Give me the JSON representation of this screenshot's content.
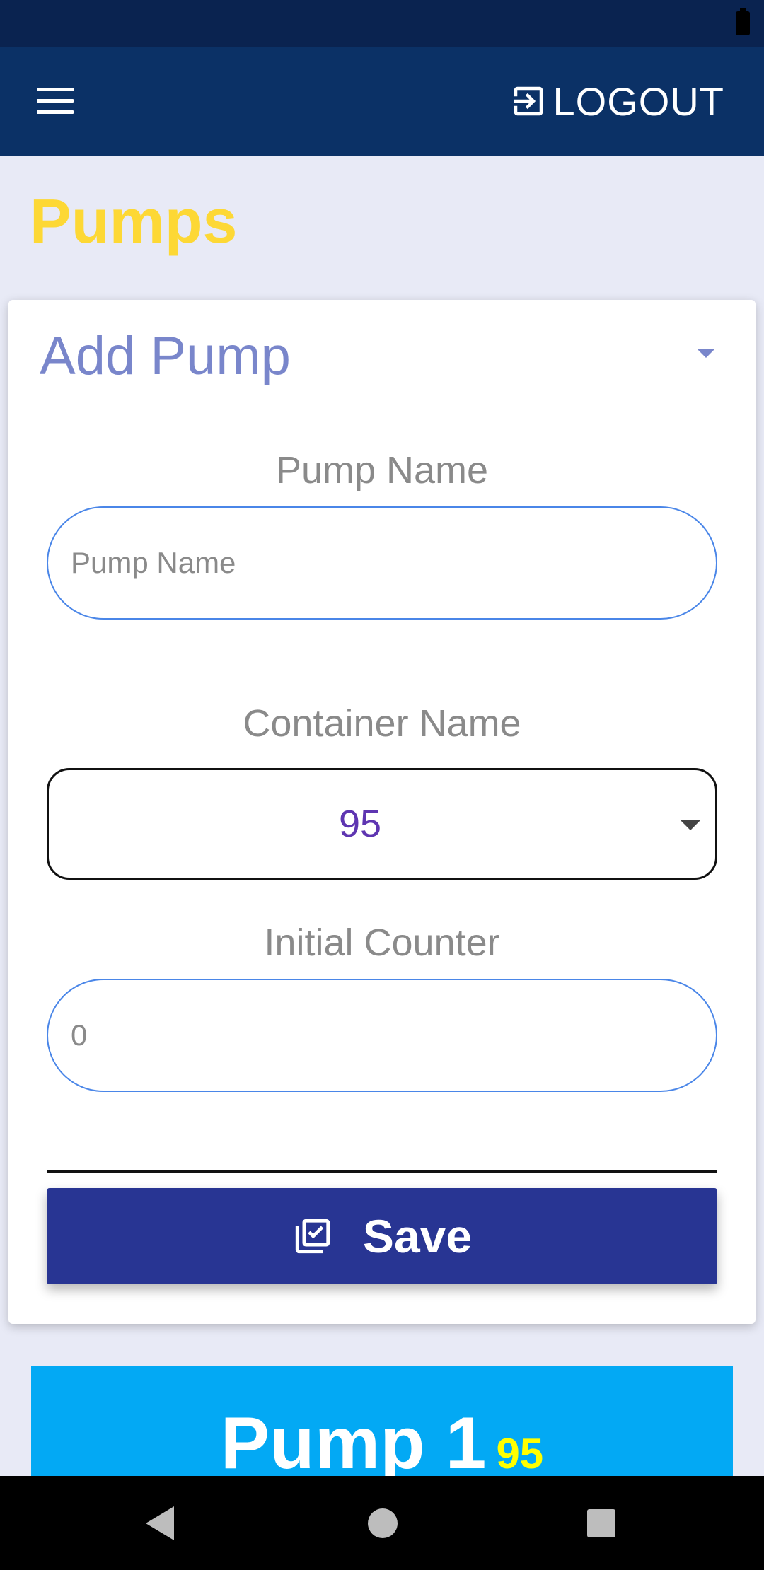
{
  "header": {
    "logout_label": "LOGOUT",
    "menu_icon": "hamburger-menu-icon",
    "logout_icon": "login-arrow-box-icon"
  },
  "page": {
    "title": "Pumps"
  },
  "form": {
    "title": "Add Pump",
    "pump_name": {
      "label": "Pump Name",
      "placeholder": "Pump Name",
      "value": ""
    },
    "container_name": {
      "label": "Container Name",
      "selected": "95"
    },
    "initial_counter": {
      "label": "Initial Counter",
      "placeholder": "0",
      "value": ""
    },
    "save_label": "Save",
    "save_icon": "library-add-check-icon"
  },
  "pumps": [
    {
      "name": "Pump 1",
      "container": "95"
    }
  ],
  "colors": {
    "status_bar": "#0a2350",
    "app_bar": "#0b3166",
    "page_title": "#fdd835",
    "card_title": "#7986cb",
    "save_button": "#283593",
    "pump_tile": "#03a9f4",
    "pump_badge": "#ffff00",
    "select_value": "#5e35b1"
  }
}
